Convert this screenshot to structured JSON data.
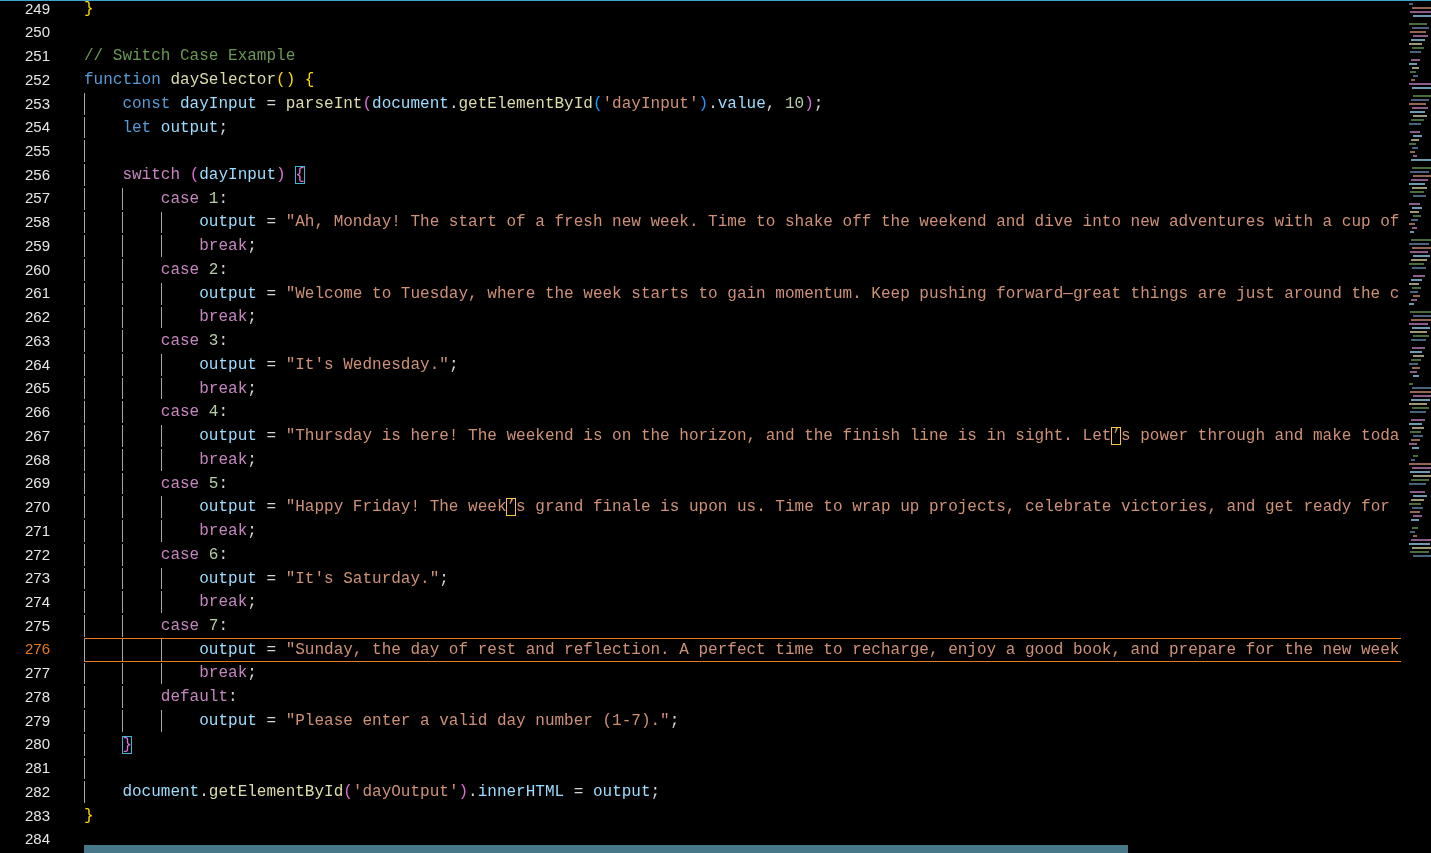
{
  "editor": {
    "lines": [
      {
        "number": "249",
        "current": false,
        "tokens": [
          {
            "kind": "bracket1",
            "text": "}"
          }
        ]
      },
      {
        "number": "250",
        "current": false
      },
      {
        "number": "251",
        "current": false,
        "tokens": [
          {
            "kind": "comment",
            "text": "// Switch Case Example"
          }
        ]
      },
      {
        "number": "252",
        "current": false,
        "tokens": [
          {
            "kind": "keyword",
            "text": "function "
          },
          {
            "kind": "function",
            "text": "daySelector"
          },
          {
            "kind": "bracket1",
            "text": "()"
          },
          {
            "kind": "bracket1",
            "text": " {"
          }
        ]
      },
      {
        "number": "253",
        "current": false,
        "tokens": [
          {
            "kind": "keyword",
            "text": "    const "
          },
          {
            "kind": "variable",
            "text": "dayInput"
          },
          {
            "kind": "plain",
            "text": " = "
          },
          {
            "kind": "function",
            "text": "parseInt"
          },
          {
            "kind": "bracket2",
            "text": "("
          },
          {
            "kind": "variable",
            "text": "document"
          },
          {
            "kind": "plain",
            "text": "."
          },
          {
            "kind": "function",
            "text": "getElementById"
          },
          {
            "kind": "bracket3",
            "text": "("
          },
          {
            "kind": "string",
            "text": "'dayInput'"
          },
          {
            "kind": "bracket3",
            "text": ")"
          },
          {
            "kind": "plain",
            "text": "."
          },
          {
            "kind": "variable",
            "text": "value"
          },
          {
            "kind": "plain",
            "text": ", "
          },
          {
            "kind": "number",
            "text": "10"
          },
          {
            "kind": "bracket2",
            "text": ")"
          },
          {
            "kind": "plain",
            "text": ";"
          }
        ]
      },
      {
        "number": "254",
        "current": false,
        "tokens": [
          {
            "kind": "keyword",
            "text": "    let "
          },
          {
            "kind": "variable",
            "text": "output"
          },
          {
            "kind": "plain",
            "text": ";"
          }
        ]
      },
      {
        "number": "255",
        "current": false
      },
      {
        "number": "256",
        "current": false,
        "tokens": [
          {
            "kind": "control",
            "text": "    switch "
          },
          {
            "kind": "bracket2",
            "text": "("
          },
          {
            "kind": "variable",
            "text": "dayInput"
          },
          {
            "kind": "bracket2",
            "text": ")"
          },
          {
            "kind": "matched",
            "text": " {"
          }
        ]
      },
      {
        "number": "257",
        "current": false,
        "tokens": [
          {
            "kind": "control",
            "text": "        case "
          },
          {
            "kind": "number",
            "text": "1"
          },
          {
            "kind": "plain",
            "text": ":"
          }
        ]
      },
      {
        "number": "258",
        "current": false,
        "tokens": [
          {
            "kind": "variable",
            "text": "            output"
          },
          {
            "kind": "plain",
            "text": " = "
          },
          {
            "kind": "string",
            "text": "\"Ah, Monday! The start of a fresh new week. Time to shake off the weekend and dive into new adventures with a cup of"
          }
        ]
      },
      {
        "number": "259",
        "current": false,
        "tokens": [
          {
            "kind": "control",
            "text": "            break"
          },
          {
            "kind": "plain",
            "text": ";"
          }
        ]
      },
      {
        "number": "260",
        "current": false,
        "tokens": [
          {
            "kind": "control",
            "text": "        case "
          },
          {
            "kind": "number",
            "text": "2"
          },
          {
            "kind": "plain",
            "text": ":"
          }
        ]
      },
      {
        "number": "261",
        "current": false,
        "tokens": [
          {
            "kind": "variable",
            "text": "            output"
          },
          {
            "kind": "plain",
            "text": " = "
          },
          {
            "kind": "string",
            "text": "\"Welcome to Tuesday, where the week starts to gain momentum. Keep pushing forward—great things are just around the c"
          }
        ]
      },
      {
        "number": "262",
        "current": false,
        "tokens": [
          {
            "kind": "control",
            "text": "            break"
          },
          {
            "kind": "plain",
            "text": ";"
          }
        ]
      },
      {
        "number": "263",
        "current": false,
        "tokens": [
          {
            "kind": "control",
            "text": "        case "
          },
          {
            "kind": "number",
            "text": "3"
          },
          {
            "kind": "plain",
            "text": ":"
          }
        ]
      },
      {
        "number": "264",
        "current": false,
        "tokens": [
          {
            "kind": "variable",
            "text": "            output"
          },
          {
            "kind": "plain",
            "text": " = "
          },
          {
            "kind": "string",
            "text": "\"It's Wednesday.\""
          },
          {
            "kind": "plain",
            "text": ";"
          }
        ]
      },
      {
        "number": "265",
        "current": false,
        "tokens": [
          {
            "kind": "control",
            "text": "            break"
          },
          {
            "kind": "plain",
            "text": ";"
          }
        ]
      },
      {
        "number": "266",
        "current": false,
        "tokens": [
          {
            "kind": "control",
            "text": "        case "
          },
          {
            "kind": "number",
            "text": "4"
          },
          {
            "kind": "plain",
            "text": ":"
          }
        ]
      },
      {
        "number": "267",
        "current": false,
        "tokens": [
          {
            "kind": "variable",
            "text": "            output"
          },
          {
            "kind": "plain",
            "text": " = "
          },
          {
            "kind": "string",
            "text": "\"Thursday is here! The weekend is on the horizon, and the finish line is in sight. Let"
          },
          {
            "kind": "ambiguous",
            "text": "’"
          },
          {
            "kind": "string",
            "text": "s power through and make toda"
          }
        ]
      },
      {
        "number": "268",
        "current": false,
        "tokens": [
          {
            "kind": "control",
            "text": "            break"
          },
          {
            "kind": "plain",
            "text": ";"
          }
        ]
      },
      {
        "number": "269",
        "current": false,
        "tokens": [
          {
            "kind": "control",
            "text": "        case "
          },
          {
            "kind": "number",
            "text": "5"
          },
          {
            "kind": "plain",
            "text": ":"
          }
        ]
      },
      {
        "number": "270",
        "current": false,
        "tokens": [
          {
            "kind": "variable",
            "text": "            output"
          },
          {
            "kind": "plain",
            "text": " = "
          },
          {
            "kind": "string",
            "text": "\"Happy Friday! The week"
          },
          {
            "kind": "ambiguous",
            "text": "’"
          },
          {
            "kind": "string",
            "text": "s grand finale is upon us. Time to wrap up projects, celebrate victories, and get ready for"
          }
        ]
      },
      {
        "number": "271",
        "current": false,
        "tokens": [
          {
            "kind": "control",
            "text": "            break"
          },
          {
            "kind": "plain",
            "text": ";"
          }
        ]
      },
      {
        "number": "272",
        "current": false,
        "tokens": [
          {
            "kind": "control",
            "text": "        case "
          },
          {
            "kind": "number",
            "text": "6"
          },
          {
            "kind": "plain",
            "text": ":"
          }
        ]
      },
      {
        "number": "273",
        "current": false,
        "tokens": [
          {
            "kind": "variable",
            "text": "            output"
          },
          {
            "kind": "plain",
            "text": " = "
          },
          {
            "kind": "string",
            "text": "\"It's Saturday.\""
          },
          {
            "kind": "plain",
            "text": ";"
          }
        ]
      },
      {
        "number": "274",
        "current": false,
        "tokens": [
          {
            "kind": "control",
            "text": "            break"
          },
          {
            "kind": "plain",
            "text": ";"
          }
        ]
      },
      {
        "number": "275",
        "current": false,
        "tokens": [
          {
            "kind": "control",
            "text": "        case "
          },
          {
            "kind": "number",
            "text": "7"
          },
          {
            "kind": "plain",
            "text": ":"
          }
        ]
      },
      {
        "number": "276",
        "current": true,
        "tokens": [
          {
            "kind": "variable",
            "text": "            output"
          },
          {
            "kind": "plain",
            "text": " = "
          },
          {
            "kind": "string",
            "text": "\"Sunday, the day of rest and reflection. A perfect time to recharge, enjoy a good book, and prepare for the new week"
          }
        ]
      },
      {
        "number": "277",
        "current": false,
        "tokens": [
          {
            "kind": "control",
            "text": "            break"
          },
          {
            "kind": "plain",
            "text": ";"
          }
        ]
      },
      {
        "number": "278",
        "current": false,
        "tokens": [
          {
            "kind": "control",
            "text": "        default"
          },
          {
            "kind": "plain",
            "text": ":"
          }
        ]
      },
      {
        "number": "279",
        "current": false,
        "tokens": [
          {
            "kind": "variable",
            "text": "            output"
          },
          {
            "kind": "plain",
            "text": " = "
          },
          {
            "kind": "string",
            "text": "\"Please enter a valid day number (1-7).\""
          },
          {
            "kind": "plain",
            "text": ";"
          }
        ]
      },
      {
        "number": "280",
        "current": false,
        "tokens": [
          {
            "kind": "matched",
            "text": "    }"
          }
        ]
      },
      {
        "number": "281",
        "current": false
      },
      {
        "number": "282",
        "current": false,
        "tokens": [
          {
            "kind": "variable",
            "text": "    document"
          },
          {
            "kind": "plain",
            "text": "."
          },
          {
            "kind": "function",
            "text": "getElementById"
          },
          {
            "kind": "bracket2",
            "text": "("
          },
          {
            "kind": "string",
            "text": "'dayOutput'"
          },
          {
            "kind": "bracket2",
            "text": ")"
          },
          {
            "kind": "plain",
            "text": "."
          },
          {
            "kind": "variable",
            "text": "innerHTML"
          },
          {
            "kind": "plain",
            "text": " = "
          },
          {
            "kind": "variable",
            "text": "output"
          },
          {
            "kind": "plain",
            "text": ";"
          }
        ]
      },
      {
        "number": "283",
        "current": false,
        "tokens": [
          {
            "kind": "bracket1",
            "text": "}"
          }
        ]
      },
      {
        "number": "284",
        "current": false
      }
    ]
  }
}
